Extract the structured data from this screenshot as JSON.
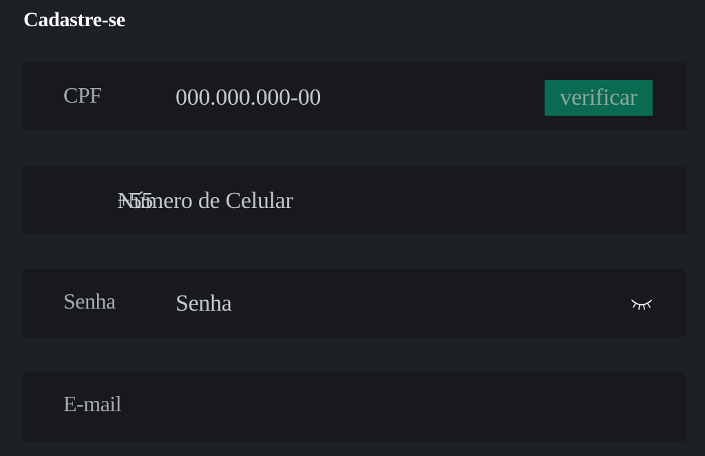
{
  "form": {
    "title": "Cadastre-se",
    "cpf": {
      "label": "CPF",
      "value": "000.000.000-00",
      "verify_label": "verificar"
    },
    "phone": {
      "prefix": "+55",
      "placeholder": "Número de Celular"
    },
    "password": {
      "label": "Senha",
      "placeholder": "Senha",
      "toggle_icon": "eye-closed-icon"
    },
    "email": {
      "label": "E-mail"
    }
  },
  "colors": {
    "background": "#1d2024",
    "field": "#17191c",
    "accent": "#0b6a52"
  }
}
